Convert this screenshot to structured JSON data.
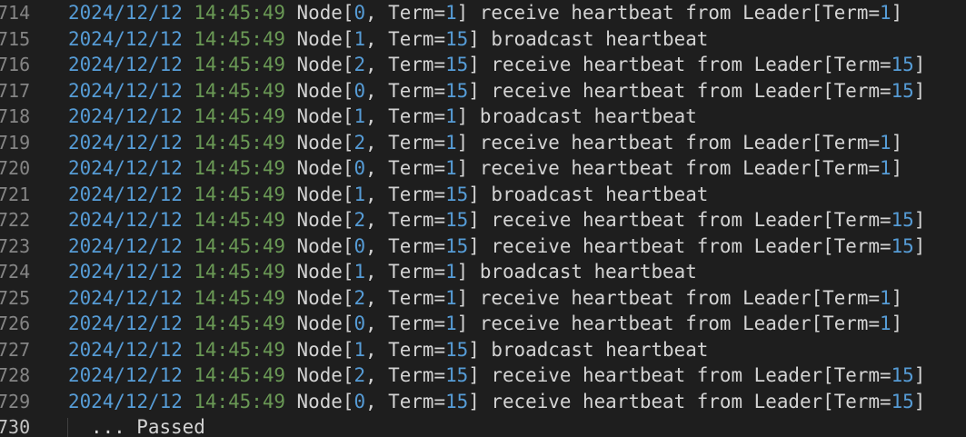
{
  "editor": {
    "lines": [
      {
        "num": "714",
        "date": "2024/12/12",
        "time": "14:45:49",
        "node": "0",
        "term": "1",
        "action": "receive heartbeat from Leader[Term=",
        "leader_term": "1"
      },
      {
        "num": "715",
        "date": "2024/12/12",
        "time": "14:45:49",
        "node": "1",
        "term": "15",
        "action": "broadcast heartbeat",
        "leader_term": ""
      },
      {
        "num": "716",
        "date": "2024/12/12",
        "time": "14:45:49",
        "node": "2",
        "term": "15",
        "action": "receive heartbeat from Leader[Term=",
        "leader_term": "15"
      },
      {
        "num": "717",
        "date": "2024/12/12",
        "time": "14:45:49",
        "node": "0",
        "term": "15",
        "action": "receive heartbeat from Leader[Term=",
        "leader_term": "15"
      },
      {
        "num": "718",
        "date": "2024/12/12",
        "time": "14:45:49",
        "node": "1",
        "term": "1",
        "action": "broadcast heartbeat",
        "leader_term": ""
      },
      {
        "num": "719",
        "date": "2024/12/12",
        "time": "14:45:49",
        "node": "2",
        "term": "1",
        "action": "receive heartbeat from Leader[Term=",
        "leader_term": "1"
      },
      {
        "num": "720",
        "date": "2024/12/12",
        "time": "14:45:49",
        "node": "0",
        "term": "1",
        "action": "receive heartbeat from Leader[Term=",
        "leader_term": "1"
      },
      {
        "num": "721",
        "date": "2024/12/12",
        "time": "14:45:49",
        "node": "1",
        "term": "15",
        "action": "broadcast heartbeat",
        "leader_term": ""
      },
      {
        "num": "722",
        "date": "2024/12/12",
        "time": "14:45:49",
        "node": "2",
        "term": "15",
        "action": "receive heartbeat from Leader[Term=",
        "leader_term": "15"
      },
      {
        "num": "723",
        "date": "2024/12/12",
        "time": "14:45:49",
        "node": "0",
        "term": "15",
        "action": "receive heartbeat from Leader[Term=",
        "leader_term": "15"
      },
      {
        "num": "724",
        "date": "2024/12/12",
        "time": "14:45:49",
        "node": "1",
        "term": "1",
        "action": "broadcast heartbeat",
        "leader_term": ""
      },
      {
        "num": "725",
        "date": "2024/12/12",
        "time": "14:45:49",
        "node": "2",
        "term": "1",
        "action": "receive heartbeat from Leader[Term=",
        "leader_term": "1"
      },
      {
        "num": "726",
        "date": "2024/12/12",
        "time": "14:45:49",
        "node": "0",
        "term": "1",
        "action": "receive heartbeat from Leader[Term=",
        "leader_term": "1"
      },
      {
        "num": "727",
        "date": "2024/12/12",
        "time": "14:45:49",
        "node": "1",
        "term": "15",
        "action": "broadcast heartbeat",
        "leader_term": ""
      },
      {
        "num": "728",
        "date": "2024/12/12",
        "time": "14:45:49",
        "node": "2",
        "term": "15",
        "action": "receive heartbeat from Leader[Term=",
        "leader_term": "15"
      },
      {
        "num": "729",
        "date": "2024/12/12",
        "time": "14:45:49",
        "node": "0",
        "term": "15",
        "action": "receive heartbeat from Leader[Term=",
        "leader_term": "15"
      }
    ],
    "last_line": {
      "num": "730",
      "text": "... Passed"
    }
  },
  "colors": {
    "background": "#1e1e1e",
    "date": "#569cd6",
    "time": "#6a9955",
    "number": "#569cd6",
    "text": "#d4d4d4",
    "line_number": "#858585"
  }
}
